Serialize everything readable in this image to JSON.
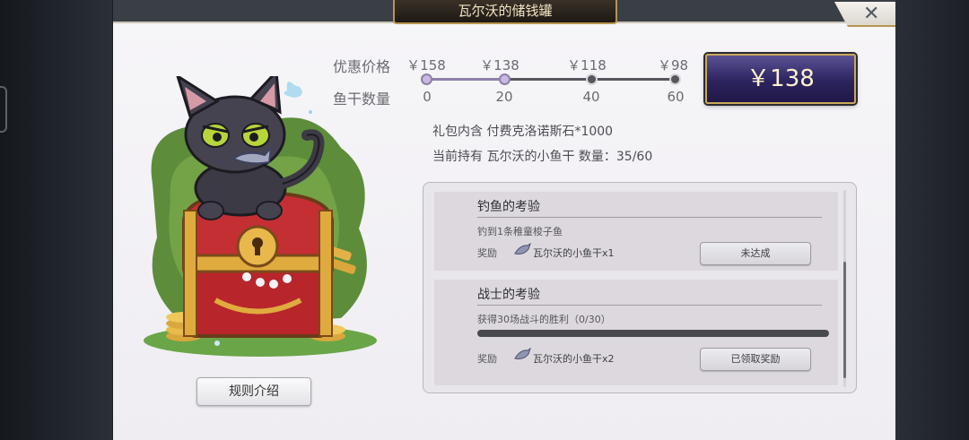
{
  "window": {
    "title": "瓦尔沃的储钱罐"
  },
  "price_section": {
    "price_label": "优惠价格",
    "fish_label": "鱼干数量",
    "prices": [
      "￥158",
      "￥138",
      "￥118",
      "￥98"
    ],
    "fish_counts": [
      "0",
      "20",
      "40",
      "60"
    ],
    "current_tier_index": 1
  },
  "buy_button": {
    "label": "￥138"
  },
  "info": {
    "contents": "礼包内含 付费克洛诺斯石*1000",
    "holding": "当前持有 瓦尔沃的小鱼干 数量：35/60"
  },
  "rules_button": {
    "label": "规则介绍"
  },
  "tasks": [
    {
      "title": "钓鱼的考验",
      "desc": "钓到1条稚童梭子鱼",
      "reward_label": "奖励",
      "reward": "瓦尔沃的小鱼干x1",
      "button": "未达成"
    },
    {
      "title": "战士的考验",
      "desc": "获得30场战斗的胜利（0/30）",
      "progress": 0,
      "reward_label": "奖励",
      "reward": "瓦尔沃的小鱼干x2",
      "button": "已领取奖励"
    }
  ],
  "icons": {
    "close": "close-icon",
    "reward": "fish-icon"
  },
  "colors": {
    "buy_button_bg": "#2c245e",
    "gold_border": "#c9a75a",
    "panel_bg": "#f6f5f8"
  }
}
